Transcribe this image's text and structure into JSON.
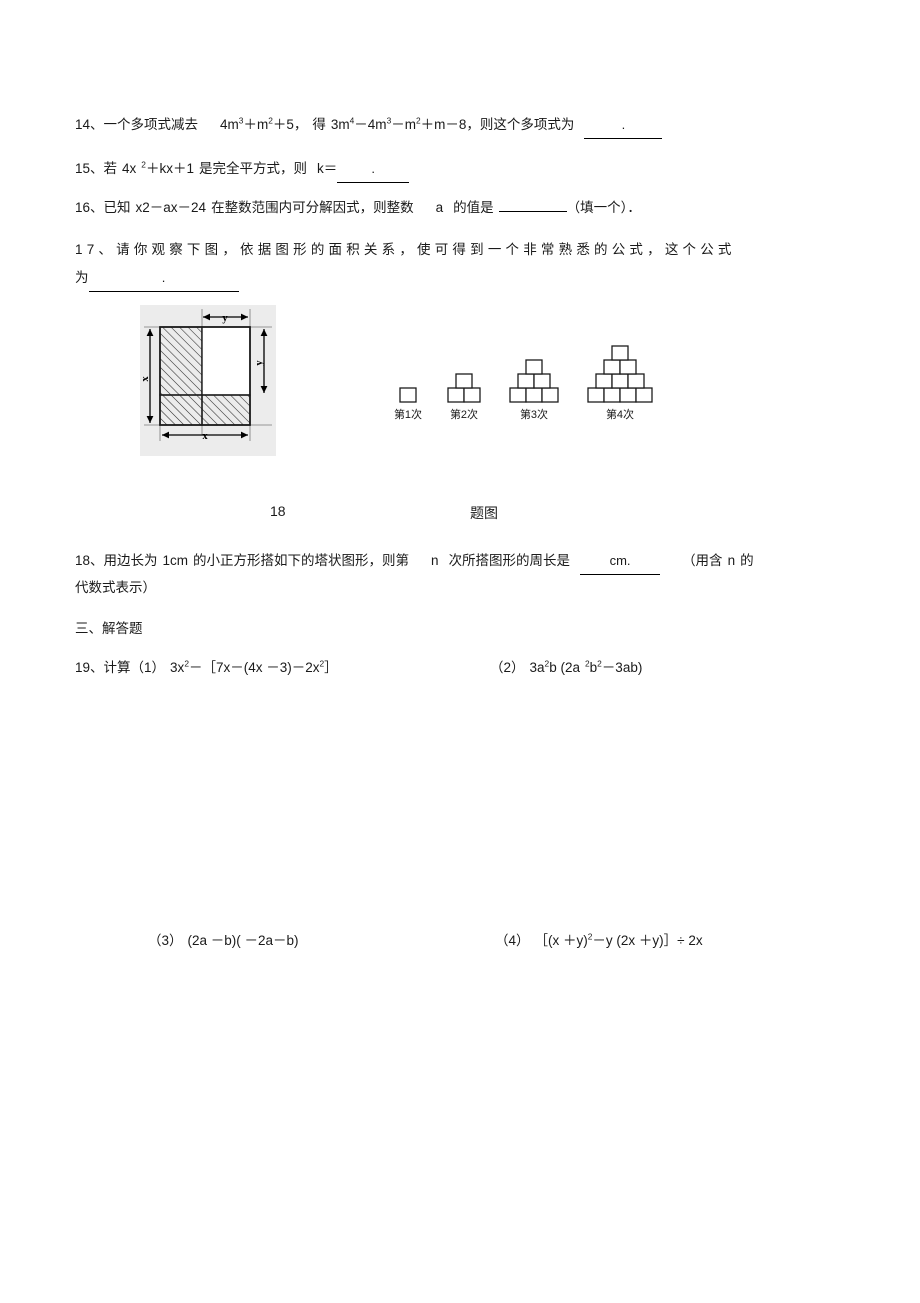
{
  "document": {
    "type": "math-worksheet",
    "language": "zh-CN"
  },
  "questions": {
    "q14": {
      "number": "14、",
      "text_a": "一个多项式减去",
      "expr_1_base1": "4m",
      "expr_1_sup1": "3",
      "expr_1_op1": "＋",
      "expr_1_base2": "m",
      "expr_1_sup2": "2",
      "expr_1_op2": "＋",
      "expr_1_tail": "5，",
      "text_b": "得",
      "expr_2_b1": "3m",
      "expr_2_s1": "4",
      "expr_2_o1": "－",
      "expr_2_b2": "4m",
      "expr_2_s2": "3",
      "expr_2_o2": "－",
      "expr_2_b3": "m",
      "expr_2_s3": "2",
      "expr_2_o3": "＋",
      "expr_2_b4": "m",
      "expr_2_o4": "－",
      "expr_2_b5": "8，",
      "text_c": "则这个多项式为",
      "answer_blank": "."
    },
    "q15": {
      "number": "15、",
      "text_a": "若",
      "expr_b1": "4x",
      "expr_s1": "2",
      "expr_rest": "＋kx＋1",
      "text_b": "是完全平方式，则",
      "text_c": "k＝",
      "answer_blank": "."
    },
    "q16": {
      "number": "16、",
      "text_a": "已知",
      "expr": "x2－ax－24",
      "text_b": "在整数范围内可分解因式，则整数",
      "var": "a",
      "text_c": "的值是",
      "answer_blank": "",
      "text_d": "（填一个）．"
    },
    "q17": {
      "number": "17、",
      "text": "请你观察下图，依据图形的面积关系，使可得到一个非常熟悉的公式，这个公式",
      "text_line2_prefix": "为",
      "answer_blank": "."
    },
    "q18": {
      "number": "18、",
      "text_a": "用边长为",
      "len": "1cm",
      "text_b": "的小正方形搭如下的塔状图形，则第",
      "var": "n",
      "text_c": "次所搭图形的周长是",
      "answer_blank": "cm.",
      "text_d": "（用含",
      "var2": "n",
      "text_e": "的",
      "text_line2": "代数式表示）"
    },
    "q19": {
      "number": "19、",
      "label": "计算",
      "part1_tag": "（1）",
      "part1_b1": "3x",
      "part1_s1": "2",
      "part1_mid": "－［7x－(4x －3)－2x",
      "part1_s2": "2",
      "part1_end": "］",
      "part2_tag": "（2）",
      "part2_a": "3a",
      "part2_sa": "2",
      "part2_b": "b (2a",
      "part2_sb": "2",
      "part2_c": "b",
      "part2_sc": "2",
      "part2_d": "－3ab)",
      "part3_tag": "（3）",
      "part3_expr": "(2a －b)( －2a－b)",
      "part4_tag": "（4）",
      "part4_a": "［(x ＋y)",
      "part4_s": "2",
      "part4_b": "－y (2x ＋y)］÷ 2x"
    }
  },
  "section_heading": {
    "label": "三、解答题"
  },
  "figure_caption": {
    "number": "18",
    "suffix": "题图"
  },
  "figure_17": {
    "name": "area-identity-square-diagram",
    "label_top": "y",
    "label_right": "y",
    "label_left": "x",
    "label_bottom": "x"
  },
  "figure_18": {
    "name": "stacked-squares-tower-diagram",
    "towers": [
      {
        "label": "第1次",
        "rows": [
          1
        ]
      },
      {
        "label": "第2次",
        "rows": [
          2,
          1
        ]
      },
      {
        "label": "第3次",
        "rows": [
          3,
          2,
          1
        ]
      },
      {
        "label": "第4次",
        "rows": [
          4,
          3,
          2,
          1
        ]
      }
    ]
  },
  "colors": {
    "text": "#1a1a1a",
    "rule": "#000000",
    "figure_stroke": "#1c1c1c",
    "figure_shade": "#e8e8e8"
  }
}
